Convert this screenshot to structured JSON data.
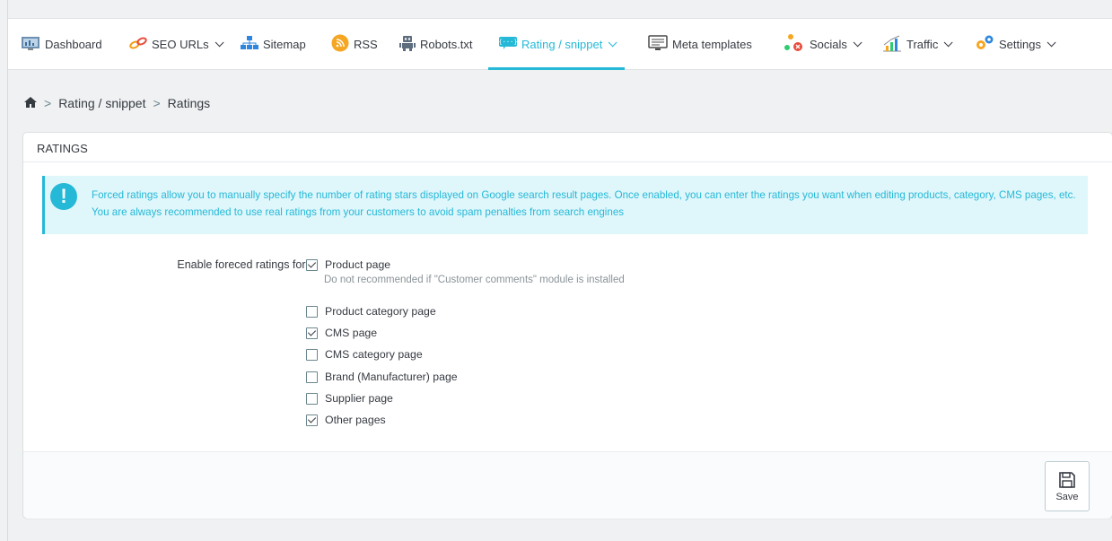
{
  "nav": {
    "tabs": [
      {
        "label": "Dashboard",
        "icon": "dashboard-icon"
      },
      {
        "label": "SEO URLs",
        "icon": "link-icon"
      },
      {
        "label": "Sitemap",
        "icon": "sitemap-icon"
      },
      {
        "label": "RSS",
        "icon": "rss-icon"
      },
      {
        "label": "Robots.txt",
        "icon": "robot-icon"
      },
      {
        "label": "Rating / snippet",
        "icon": "snippet-icon"
      },
      {
        "label": "Meta templates",
        "icon": "monitor-icon"
      },
      {
        "label": "Socials",
        "icon": "share-icon"
      },
      {
        "label": "Traffic",
        "icon": "traffic-chart-icon"
      },
      {
        "label": "Settings",
        "icon": "gears-icon"
      }
    ],
    "active_color": "#25b9d7"
  },
  "breadcrumb": {
    "home_icon": "home-icon",
    "items": [
      "Rating / snippet",
      "Ratings"
    ]
  },
  "panel": {
    "title": "RATINGS",
    "alert": "Forced ratings allow you to manually specify the number of rating stars displayed on Google search result pages. Once enabled, you can enter the ratings you want when editing products, category, CMS pages, etc. You are always recommended to use real ratings from your customers to avoid spam penalties from search engines",
    "field_label": "Enable foreced ratings for:",
    "product_hint": "Do not recommended if \"Customer comments\" module is installed",
    "options": [
      {
        "label": "Product page",
        "checked": true
      },
      {
        "label": "Product category page",
        "checked": false
      },
      {
        "label": "CMS page",
        "checked": true
      },
      {
        "label": "CMS category page",
        "checked": false
      },
      {
        "label": "Brand (Manufacturer) page",
        "checked": false
      },
      {
        "label": "Supplier page",
        "checked": false
      },
      {
        "label": "Other pages",
        "checked": true
      }
    ],
    "save_label": "Save"
  }
}
